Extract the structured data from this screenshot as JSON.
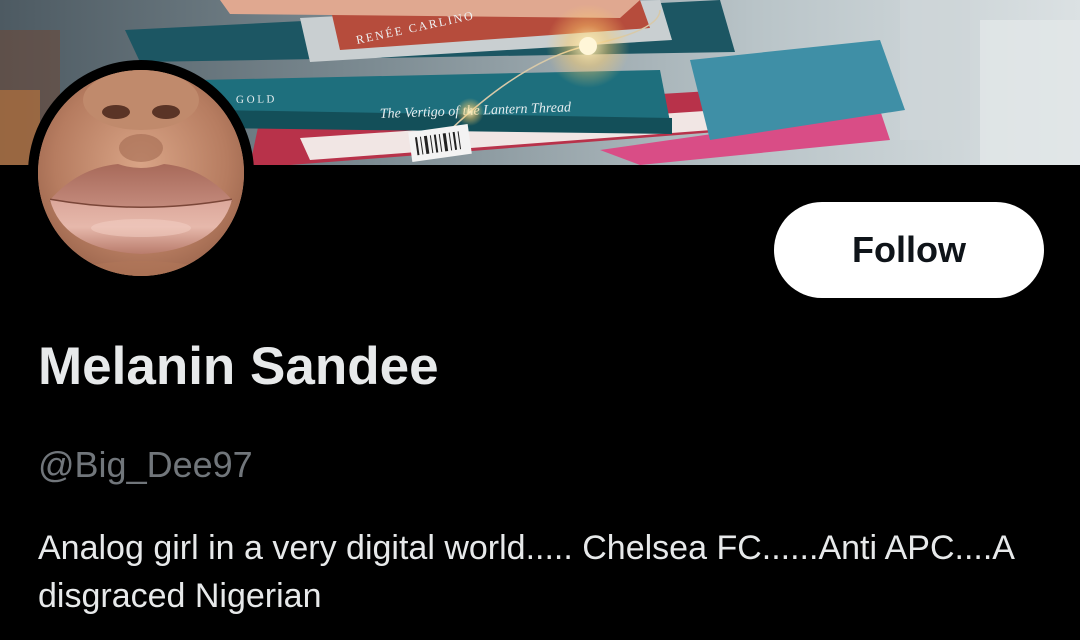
{
  "banner": {
    "icon": "books-photo",
    "book_author_text": "RENÉE CARLINO"
  },
  "avatar": {
    "icon": "lips-photo"
  },
  "profile": {
    "display_name": "Melanin Sandee",
    "handle": "@Big_Dee97",
    "bio": "Analog girl in a very digital world..... Chelsea FC......Anti APC....A disgraced Nigerian"
  },
  "actions": {
    "follow_label": "Follow"
  },
  "colors": {
    "background": "#000000",
    "primary_text": "#e7e9ea",
    "secondary_text": "#71767b",
    "button_bg": "#ffffff",
    "button_text": "#0f1419"
  }
}
